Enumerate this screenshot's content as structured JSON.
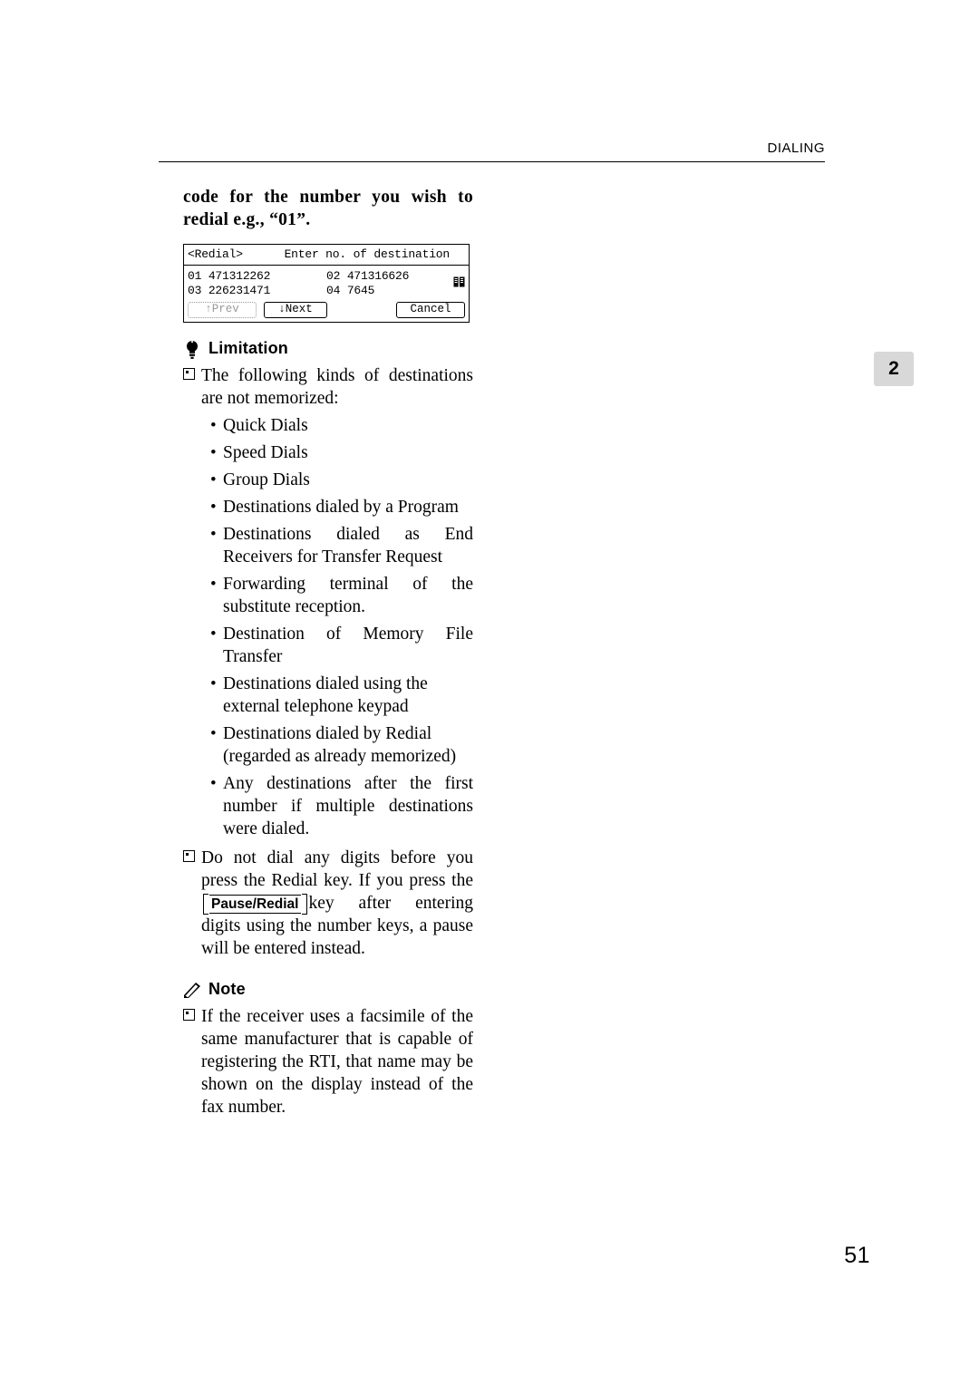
{
  "header": {
    "running_head": "DIALING"
  },
  "chapter_tab": {
    "number": "2"
  },
  "step": {
    "text": "code for the number you wish to redial e.g., “01”."
  },
  "lcd": {
    "title": "<Redial>",
    "prompt": "Enter no. of destination",
    "icon": "address-book-icon",
    "entries": [
      {
        "index": "01",
        "number": "471312262"
      },
      {
        "index": "02",
        "number": "471316626"
      },
      {
        "index": "03",
        "number": "226231471"
      },
      {
        "index": "04",
        "number": "7645"
      }
    ],
    "buttons": {
      "prev": "↑Prev",
      "next": "↓Next",
      "cancel": "Cancel"
    }
  },
  "limitation": {
    "heading": "Limitation",
    "icon": "limitation-icon",
    "intro": "The following kinds of destinations are not memorized:",
    "items": [
      "Quick Dials",
      "Speed Dials",
      "Group Dials",
      "Destinations dialed by a Program",
      "Destinations dialed as End Receivers for Transfer Request",
      "Forwarding terminal of the substitute reception.",
      "Destination of Memory File Transfer",
      "Destinations dialed using the external telephone keypad",
      "Destinations dialed by Redial (regarded as already memorized)",
      "Any destinations after the first number if multiple destinations were dialed."
    ],
    "second_note_part1": "Do not dial any digits before you press the Redial key. If you press the",
    "second_note_key": "Pause/Redial",
    "second_note_part2": "key after entering digits using the number keys, a pause will be entered instead."
  },
  "note": {
    "heading": "Note",
    "icon": "note-pencil-icon",
    "text": "If the receiver uses a facsimile of the same manufacturer that is capable of registering the RTI, that name may be shown on the display instead of the fax number."
  },
  "footer": {
    "page_number": "51"
  }
}
